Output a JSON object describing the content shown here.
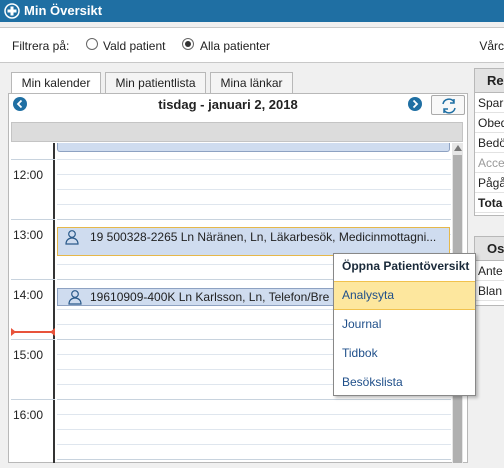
{
  "window": {
    "title": "Min Översikt"
  },
  "filter": {
    "label": "Filtrera på:",
    "options": [
      {
        "label": "Vald patient",
        "selected": false
      },
      {
        "label": "Alla patienter",
        "selected": true
      }
    ],
    "right_label": "Vårc"
  },
  "tabs": [
    {
      "label": "Min kalender",
      "active": true
    },
    {
      "label": "Min patientlista",
      "active": false
    },
    {
      "label": "Mina länkar",
      "active": false
    }
  ],
  "calendar": {
    "date_label": "tisdag - januari 2, 2018",
    "time_labels": [
      "12:00",
      "13:00",
      "14:00",
      "15:00",
      "16:00"
    ],
    "appointments": [
      {
        "text": "19 500328-2265 Ln Näränen, Ln, Läkarbesök, Medicinmottagni..."
      },
      {
        "text": "19610909-400K Ln Karlsson, Ln, Telefon/Bre"
      }
    ]
  },
  "right_panel": {
    "box1": {
      "title": "Re",
      "rows": [
        {
          "label": "Spar",
          "style": "normal"
        },
        {
          "label": "Obed",
          "style": "normal"
        },
        {
          "label": "Bedö",
          "style": "normal"
        },
        {
          "label": "Accer",
          "style": "dim"
        },
        {
          "label": "Pågå",
          "style": "normal"
        },
        {
          "label": "Tota",
          "style": "bold"
        }
      ]
    },
    "box2": {
      "title": "Os",
      "rows": [
        {
          "label": "Ante"
        },
        {
          "label": "Blan"
        }
      ]
    }
  },
  "context_menu": {
    "title": "Öppna Patientöversikt",
    "items": [
      {
        "label": "Analysyta",
        "highlighted": true
      },
      {
        "label": "Journal",
        "highlighted": false
      },
      {
        "label": "Tidbok",
        "highlighted": false
      },
      {
        "label": "Besökslista",
        "highlighted": false
      }
    ]
  },
  "colors": {
    "titlebar": "#1f6fa3",
    "appointment": "#cfdcef",
    "highlight": "#fde79e",
    "now_line": "#e8533b"
  }
}
